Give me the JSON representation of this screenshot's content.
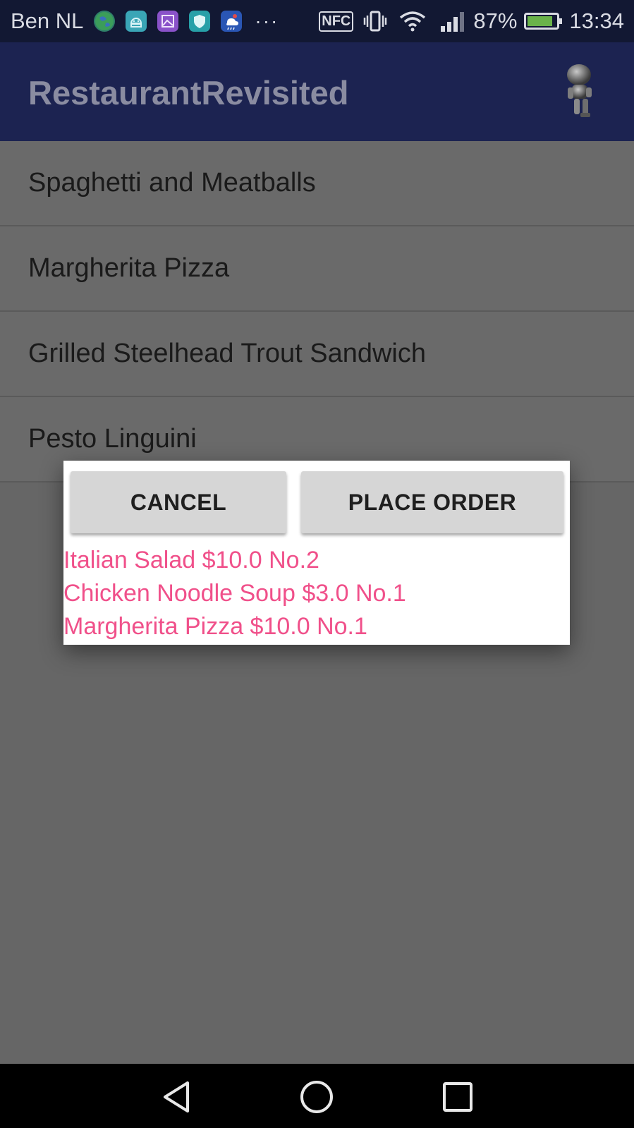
{
  "status_bar": {
    "carrier": "Ben NL",
    "nfc": "NFC",
    "battery_percent": "87%",
    "time": "13:34",
    "battery_level": 0.87,
    "notification_icons": [
      "globe-icon",
      "android-icon",
      "gallery-icon",
      "shield-icon",
      "weather-icon"
    ],
    "more_indicator": "···"
  },
  "app_bar": {
    "title": "RestaurantRevisited",
    "avatar_icon": "robot-avatar-icon"
  },
  "menu": {
    "items": [
      {
        "label": "Spaghetti and Meatballs"
      },
      {
        "label": "Margherita Pizza"
      },
      {
        "label": "Grilled Steelhead Trout Sandwich"
      },
      {
        "label": "Pesto Linguini"
      }
    ]
  },
  "dialog": {
    "cancel_label": "CANCEL",
    "place_order_label": "PLACE ORDER",
    "order_lines": [
      "Italian Salad $10.0 No.2",
      "Chicken Noodle Soup $3.0 No.1",
      "Margherita Pizza $10.0 No.1"
    ]
  },
  "nav_bar": {
    "back_icon": "back-icon",
    "home_icon": "home-icon",
    "recents_icon": "recents-icon"
  },
  "colors": {
    "app_bar": "#1c2351",
    "status_bar": "#121833",
    "order_text": "#f0508a",
    "dim_background": "#666666"
  }
}
